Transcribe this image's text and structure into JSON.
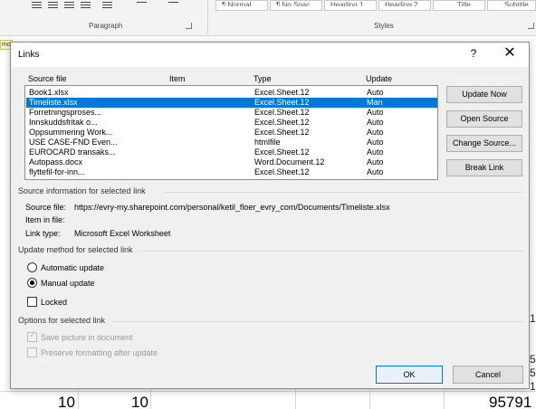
{
  "background": {
    "group_paragraph": "Paragraph",
    "group_styles": "Styles",
    "styles": [
      "¶ Normal",
      "¶ No Spac...",
      "Heading 1",
      "Heading 2",
      "Title",
      "Subtitle"
    ],
    "tab_label": "mo",
    "sheet_values": [
      "10",
      "10",
      "95791"
    ],
    "edge_chars": [
      "1",
      "5",
      "5",
      "1"
    ]
  },
  "dialog": {
    "title": "Links",
    "help_label": "?",
    "close_label": "✕",
    "columns": {
      "source": "Source file",
      "item": "Item",
      "type": "Type",
      "update": "Update"
    },
    "links": [
      {
        "source": "Book1.xlsx",
        "type": "Excel.Sheet.12",
        "update": "Auto"
      },
      {
        "source": "Timeliste.xlsx",
        "type": "Excel.Sheet.12",
        "update": "Man",
        "selected": true
      },
      {
        "source": "Forretningsproses...",
        "type": "Excel.Sheet.12",
        "update": "Auto"
      },
      {
        "source": "Innskuddsfritak o...",
        "type": "Excel.Sheet.12",
        "update": "Auto"
      },
      {
        "source": "Oppsummering Work...",
        "type": "Excel.Sheet.12",
        "update": "Auto"
      },
      {
        "source": "USE CASE-FND Even...",
        "type": "htmlfile",
        "update": "Auto"
      },
      {
        "source": "EUROCARD transaks...",
        "type": "Excel.Sheet.12",
        "update": "Auto"
      },
      {
        "source": "Autopass.docx",
        "type": "Word.Document.12",
        "update": "Auto"
      },
      {
        "source": "flyttefil-for-inn...",
        "type": "Excel.Sheet.12",
        "update": "Auto"
      }
    ],
    "buttons": {
      "update_now": "Update Now",
      "open_source": "Open Source",
      "change_source": "Change Source...",
      "break_link": "Break Link",
      "ok": "OK",
      "cancel": "Cancel"
    },
    "source_info": {
      "heading": "Source information for selected link",
      "source_file_label": "Source file:",
      "source_file_value": "https://evry-my.sharepoint.com/personal/ketil_floer_evry_com/Documents/Timeliste.xlsx",
      "item_label": "Item in file:",
      "item_value": "",
      "link_type_label": "Link type:",
      "link_type_value": "Microsoft Excel Worksheet"
    },
    "update_method": {
      "heading": "Update method for selected link",
      "automatic": "Automatic update",
      "manual": "Manual update",
      "locked": "Locked",
      "selected": "manual"
    },
    "options": {
      "heading": "Options for selected link",
      "save_picture": "Save picture in document",
      "preserve_formatting": "Preserve formatting after update"
    }
  }
}
